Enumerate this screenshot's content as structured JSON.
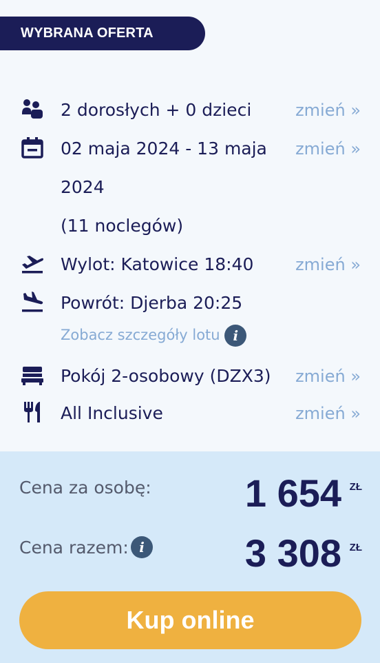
{
  "header": {
    "badge": "WYBRANA OFERTA"
  },
  "offer": {
    "travellers": {
      "text": "2 dorosłych + 0 dzieci",
      "icon": "people-icon",
      "change": "zmień »"
    },
    "dates": {
      "line1": "02 maja 2024 - 13 maja",
      "line2": "2024",
      "line3": "(11 noclegów)",
      "icon": "calendar-icon",
      "change": "zmień »"
    },
    "departure": {
      "text": "Wylot: Katowice 18:40",
      "icon": "plane-takeoff-icon",
      "change": "zmień »"
    },
    "return": {
      "text": "Powrót: Djerba 20:25",
      "icon": "plane-landing-icon"
    },
    "flight_details_link": "Zobacz szczegóły lotu",
    "room": {
      "text": "Pokój 2-osobowy (DZX3)",
      "icon": "bed-icon",
      "change": "zmień »"
    },
    "board": {
      "text": "All Inclusive",
      "icon": "cutlery-icon",
      "change": "zmień »"
    }
  },
  "pricing": {
    "per_person_label": "Cena za osobę:",
    "per_person_value": "1 654",
    "total_label": "Cena razem:",
    "total_value": "3 308",
    "currency": "ZŁ"
  },
  "cta": {
    "buy_label": "Kup online"
  },
  "colors": {
    "navy": "#1b1d57",
    "link": "#86aad4",
    "panel": "#f4f8fc",
    "price_panel": "#d5e9f9",
    "button": "#efb140"
  }
}
